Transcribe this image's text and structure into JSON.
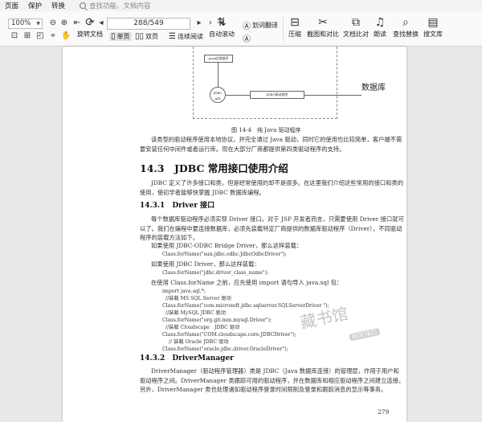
{
  "menu": {
    "items": [
      "页面",
      "保护",
      "转换"
    ],
    "search_placeholder": "查找功能、文档内容"
  },
  "toolbar": {
    "zoom": "100%",
    "page_indicator": "288/549",
    "rotate_label": "旋转文档",
    "single_label": "单页",
    "double_label": "双页",
    "continuous_label": "连续阅读",
    "autoscroll_label": "自动滚动",
    "translate_word_label": "划词翻译",
    "translate_full_label": "全文翻译",
    "compress_label": "压缩",
    "screenshot_compare_label": "截图和对比",
    "doc_compare_label": "文档比对",
    "read_aloud_label": "朗读",
    "find_replace_label": "查找替换",
    "search_library_label": "搜文库"
  },
  "document": {
    "figure": {
      "box_top": "Java应用程序",
      "circle": "JDBC API",
      "box_mid": "JDBC驱动程序",
      "db": "数据库",
      "caption": "图 14-4　纯 Java 驱动程序"
    },
    "para1": "该类型的驱动程序使用本地协议，并完全通过 Java 驱动，同时它的使用也比较简单，客户端不需要安装任何中间件或者运行库。现在大部分厂商都提供第四类驱动程序的支持。",
    "h2": "14.3　JDBC 常用接口使用介绍",
    "para2": "JDBC 定义了许多接口和类，但是经常使用的却不是很多。在这里我们介绍这些常用的接口和类的使用，使初学者能够快掌握 JDBC 数据库编程。",
    "h3_1": "14.3.1　Driver 接口",
    "para3": "每个数据库驱动程序必须实现 Driver 接口。对于 JSP 开发者而言，只需要使用 Driver 接口就可以了。我们在编程中要连接数据库，必须先装载特定厂商提供的数据库驱动程序（Driver），不同驱动程序的装载方法如下。",
    "line_odbc": "如果使用 JDBC-ODBC Bridge Driver，那么这样装载：",
    "code_odbc": "Class.forName(\"sun.jdbc.odbc.JdbcOdbcDriver\");",
    "line_driver": "如果使用 JDBC Driver，那么这样装载：",
    "code_driver": "Class.forName(\"jdbc.driver_class_name\");",
    "line_import": "在使用 Class.forName 之前，应先使用 import 语句导入 java.sql 包：",
    "code_block": [
      "import java.sql.*;",
      "//装载  MS SQL Server 驱动",
      "Class.forName(\"com.microsoft.jdbc.sqlserver.SQLServerDriver \");",
      "//装载 MySQL JDBC 驱动",
      "Class.forName(\"org.git.mm.mysql.Driver\");",
      "//装载 Cloudscape　JDBC 驱动",
      "Class.forName(\"COM.cloudscape.core.JDBCDriver\");",
      "// 装载 Oracle JDBC 驱动",
      "Class.forName(\"oracle.jdbc.driver.OracleDriver\");"
    ],
    "h3_2": "14.3.2　DriverManager",
    "para4": "DriverManager（驱动程序管理器）类是 JDBC（Java 数据库连接）的管理层，作用于用户和驱动程序之间。DriverManager 类跟踪可用的驱动程序，并在数据库和相应驱动程序之间建立连接。另外，DriverManager 类也处理诸如驱动程序登录时间限制及登录和跟踪消息的显示等事务。",
    "page_number": "279",
    "watermark_text": "藏书馆",
    "watermark_badge": "BOOKG"
  }
}
